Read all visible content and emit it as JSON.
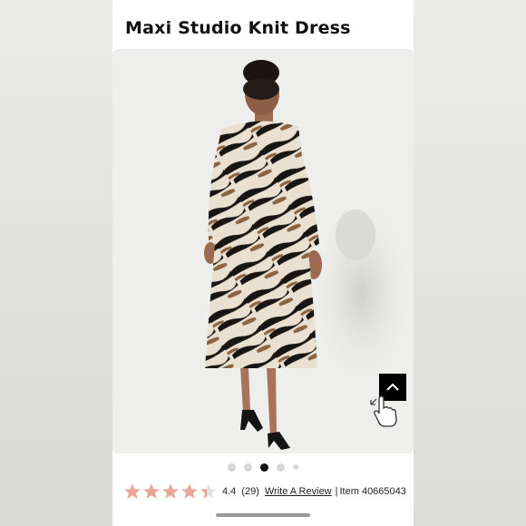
{
  "product": {
    "title": "Maxi Studio Knit Dress"
  },
  "gallery": {
    "image_count": 5,
    "active_index": 2
  },
  "rating": {
    "score": "4.4",
    "stars_value": 4.4,
    "stars_max": 5,
    "count": "(29)",
    "write_review": "Write A Review",
    "separator": "|",
    "item_label": "Item 40665043"
  },
  "colors": {
    "star": "#e9a698",
    "star_empty": "#e3e3e3",
    "scroll_button": "#000000",
    "active_dot": "#111111"
  },
  "icons": {
    "scroll_top": "chevron-up-icon",
    "cursor": "hand-pointer-icon"
  }
}
